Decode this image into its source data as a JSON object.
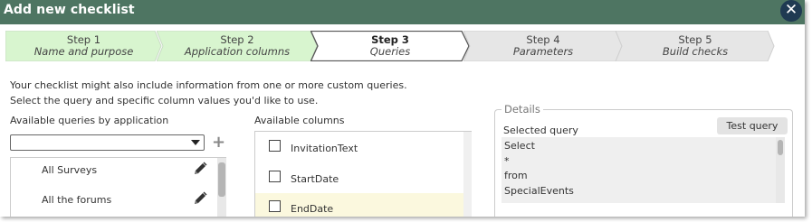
{
  "dialog": {
    "title": "Add new checklist",
    "close_glyph": "✕"
  },
  "steps": [
    {
      "label": "Step 1",
      "sub": "Name and purpose",
      "state": "done"
    },
    {
      "label": "Step 2",
      "sub": "Application columns",
      "state": "done"
    },
    {
      "label": "Step 3",
      "sub": "Queries",
      "state": "active"
    },
    {
      "label": "Step 4",
      "sub": "Parameters",
      "state": "todo"
    },
    {
      "label": "Step 5",
      "sub": "Build checks",
      "state": "todo"
    }
  ],
  "intro": {
    "line1": "Your checklist might also include information from one or more custom queries.",
    "line2": "Select the query and specific column values you'd like to use."
  },
  "queries": {
    "label": "Available queries by application",
    "select_value": "",
    "add_glyph": "+",
    "items": [
      {
        "name": "All Surveys"
      },
      {
        "name": "All the forums"
      }
    ]
  },
  "columns": {
    "label": "Available columns",
    "items": [
      {
        "name": "InvitationText",
        "checked": false
      },
      {
        "name": "StartDate",
        "checked": false
      },
      {
        "name": "EndDate",
        "checked": false
      }
    ]
  },
  "details": {
    "legend": "Details",
    "test_button": "Test query",
    "selected_query_label": "Selected query",
    "sql_lines": [
      "Select",
      "*",
      "from",
      "SpecialEvents"
    ]
  },
  "colors": {
    "titlebar": "#4e7562",
    "close_button": "#1f3a52",
    "step_done": "#d8f5cf",
    "step_active": "#ffffff",
    "step_todo": "#e6e6e6",
    "highlight_row": "#fbf8de"
  },
  "icons": {
    "close": "close-icon",
    "dropdown": "chevron-down-icon",
    "add": "plus-icon",
    "edit": "pencil-icon",
    "checkbox": "checkbox-icon"
  }
}
